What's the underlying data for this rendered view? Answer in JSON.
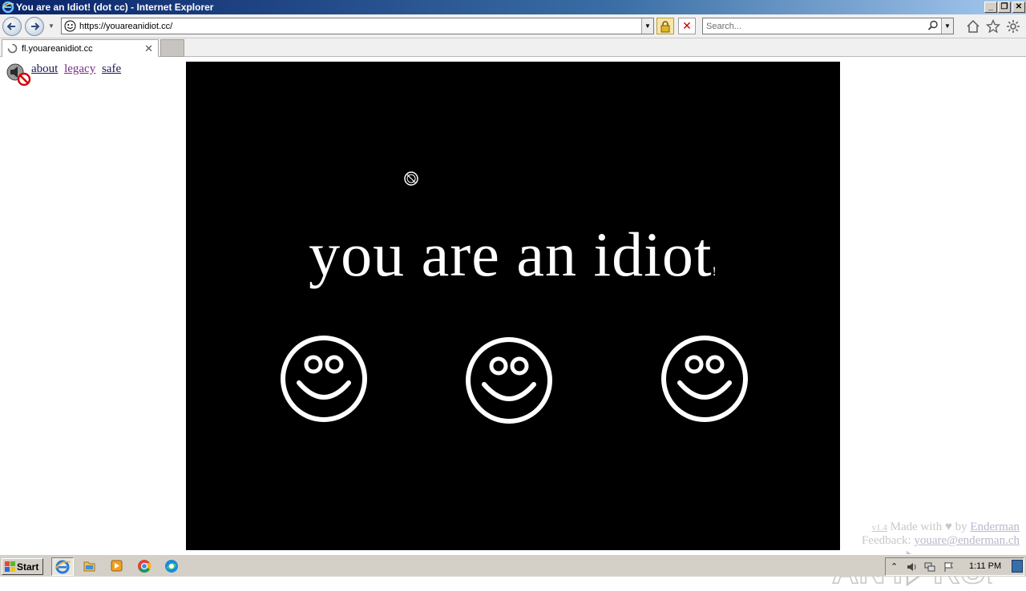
{
  "window": {
    "title": "You are an Idiot! (dot cc) - Internet Explorer"
  },
  "navbar": {
    "url": "https://youareanidiot.cc/",
    "search_placeholder": "Search..."
  },
  "tabs": [
    {
      "label": "fl.youareanidiot.cc",
      "loading": true
    }
  ],
  "page": {
    "links": {
      "about": "about",
      "legacy": "legacy",
      "safe": "safe"
    },
    "headline": "you are an idiot",
    "headline_trailing_glyph": "!",
    "smiley_count": 3,
    "footer": {
      "version": "v1.4",
      "made_with": "Made with",
      "heart": "♥",
      "by": "by",
      "author": "Enderman",
      "feedback_label": "Feedback:",
      "feedback_email": "youare@enderman.ch"
    }
  },
  "watermark": {
    "text": "ANY.RUN"
  },
  "taskbar": {
    "start_label": "Start",
    "clock": "1:11 PM",
    "apps": [
      "internet-explorer",
      "file-explorer",
      "media-player",
      "chrome",
      "edge"
    ]
  },
  "colors": {
    "titlebar": "#0a246a",
    "flash_bg": "#000000",
    "headline": "#ffffff",
    "link_visited": "#7a2b8a",
    "taskbar": "#d4d0c8"
  }
}
